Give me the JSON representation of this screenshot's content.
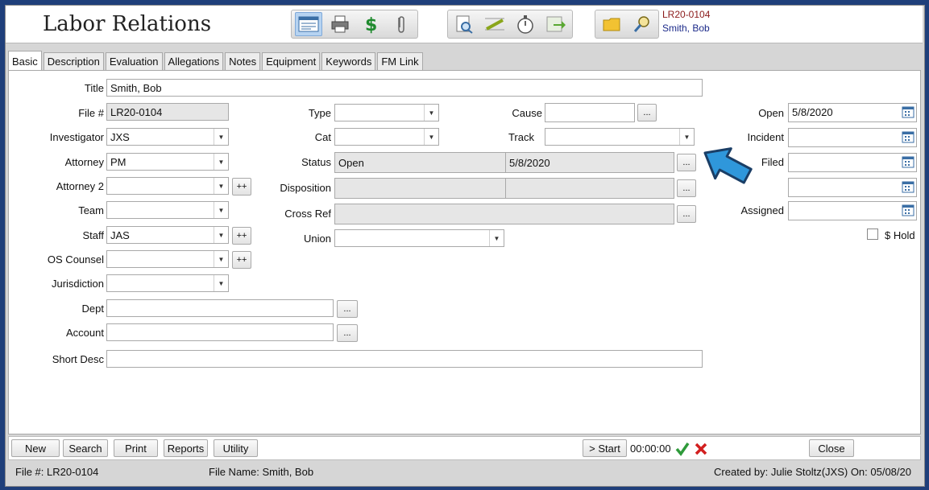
{
  "header": {
    "app_title": "Labor Relations",
    "record_id": "LR20-0104",
    "record_name": "Smith, Bob",
    "toolbar_icons": [
      "form-view-icon",
      "printer-icon",
      "dollar-icon",
      "paperclip-icon",
      "preview-icon",
      "edit-icon",
      "stopwatch-icon",
      "export-icon",
      "folder-icon",
      "search-key-icon"
    ]
  },
  "tabs": [
    "Basic",
    "Description",
    "Evaluation",
    "Allegations",
    "Notes",
    "Equipment",
    "Keywords",
    "FM Link"
  ],
  "form": {
    "title": {
      "label": "Title",
      "value": "Smith, Bob"
    },
    "file_no": {
      "label": "File #",
      "value": "LR20-0104"
    },
    "investigator": {
      "label": "Investigator",
      "value": "JXS"
    },
    "attorney": {
      "label": "Attorney",
      "value": "PM"
    },
    "attorney2": {
      "label": "Attorney 2",
      "value": ""
    },
    "team": {
      "label": "Team",
      "value": ""
    },
    "staff": {
      "label": "Staff",
      "value": "JAS"
    },
    "os_counsel": {
      "label": "OS Counsel",
      "value": ""
    },
    "jurisdiction": {
      "label": "Jurisdiction",
      "value": ""
    },
    "dept": {
      "label": "Dept",
      "value": ""
    },
    "account": {
      "label": "Account",
      "value": ""
    },
    "short_desc": {
      "label": "Short Desc",
      "value": ""
    },
    "type": {
      "label": "Type",
      "value": ""
    },
    "cat": {
      "label": "Cat",
      "value": ""
    },
    "status": {
      "label": "Status",
      "value": "Open",
      "date": "5/8/2020"
    },
    "disposition": {
      "label": "Disposition",
      "value": "",
      "date": ""
    },
    "cross_ref": {
      "label": "Cross Ref",
      "value": ""
    },
    "union": {
      "label": "Union",
      "value": ""
    },
    "cause": {
      "label": "Cause",
      "value": ""
    },
    "track": {
      "label": "Track",
      "value": ""
    },
    "open": {
      "label": "Open",
      "value": "5/8/2020"
    },
    "incident": {
      "label": "Incident",
      "value": ""
    },
    "filed": {
      "label": "Filed",
      "value": ""
    },
    "blank_date": {
      "label": "",
      "value": ""
    },
    "assigned": {
      "label": "Assigned",
      "value": ""
    },
    "hold": {
      "label": "$ Hold",
      "checked": false
    },
    "ellipsis": "...",
    "plusplus": "++"
  },
  "bottom": {
    "new": "New",
    "search": "Search",
    "print": "Print",
    "reports": "Reports",
    "utility": "Utility",
    "start": "> Start",
    "timer": "00:00:00",
    "close": "Close"
  },
  "statusbar": {
    "file": "File #: LR20-0104",
    "file_name": "File Name: Smith, Bob",
    "created": "Created by: Julie Stoltz(JXS) On: 05/08/20"
  },
  "colors": {
    "accent_arrow": "#2f97db",
    "record_id": "#8b1a1a",
    "record_name": "#1c2a8a",
    "frame": "#1f3f7a"
  }
}
